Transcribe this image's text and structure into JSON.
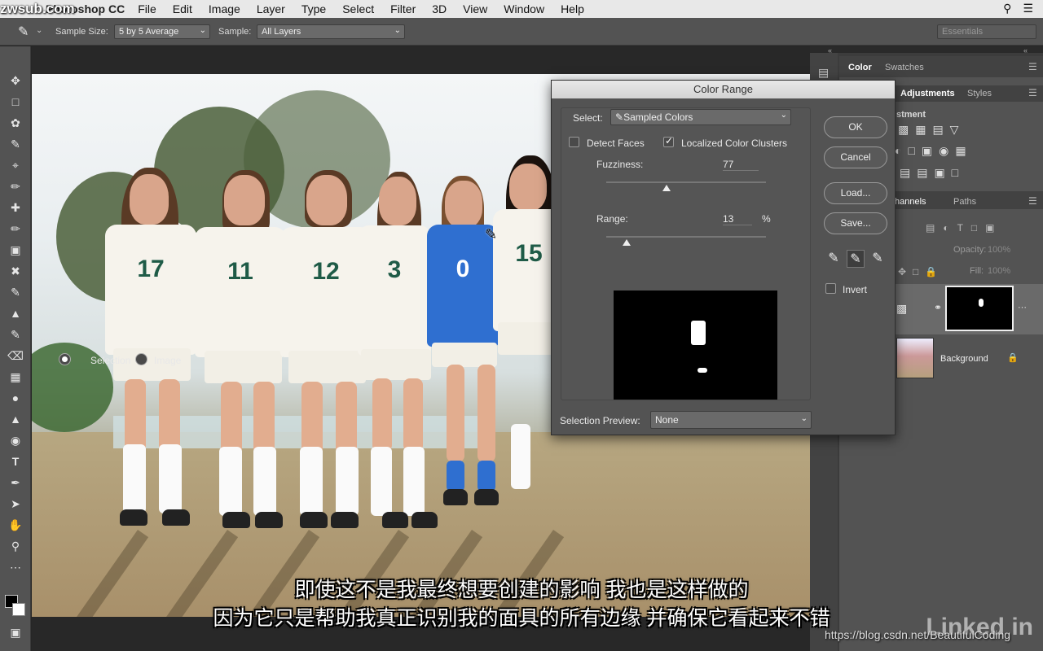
{
  "app": {
    "watermark": "zwsub.com",
    "title": "Photoshop CC"
  },
  "menu": {
    "items": [
      "File",
      "Edit",
      "Image",
      "Layer",
      "Type",
      "Select",
      "Filter",
      "3D",
      "View",
      "Window",
      "Help"
    ]
  },
  "options": {
    "sample_size_label": "Sample Size:",
    "sample_size_value": "5 by 5 Average",
    "sample_label": "Sample:",
    "sample_value": "All Layers",
    "workspace": "Essentials"
  },
  "panels": {
    "tab_color": "Color",
    "tab_swatches": "Swatches",
    "tab_adjustments": "Adjustments",
    "tab_styles": "Styles",
    "adjust_caption": "stment",
    "tab_channels": "hannels",
    "tab_paths": "Paths",
    "opacity_label": "Opacity:",
    "opacity_value": "100%",
    "fill_label": "Fill:",
    "fill_value": "100%",
    "layer_background": "Background"
  },
  "dialog": {
    "title": "Color Range",
    "select_label": "Select:",
    "select_value": "Sampled Colors",
    "detect_faces": "Detect Faces",
    "localized": "Localized Color Clusters",
    "fuzziness_label": "Fuzziness:",
    "fuzziness_value": "77",
    "fuzziness_fraction": 0.38,
    "range_label": "Range:",
    "range_value": "13",
    "range_unit": "%",
    "range_fraction": 0.13,
    "ok": "OK",
    "cancel": "Cancel",
    "load": "Load...",
    "save": "Save...",
    "invert": "Invert",
    "radio_selection": "Selection",
    "radio_image": "Image",
    "preview_label": "Selection Preview:",
    "preview_value": "None"
  },
  "photo": {
    "jerseys": [
      "17",
      "11",
      "12",
      "3",
      "0",
      "15"
    ]
  },
  "subtitles": {
    "line1": "即使这不是我最终想要创建的影响  我也是这样做的",
    "line2": "因为它只是帮助我真正识别我的面具的所有边缘  并确保它看起来不错"
  },
  "overlay": {
    "csdn": "https://blog.csdn.net/BeautifulCoding",
    "linkedin": "Linked in"
  },
  "colors": {
    "jersey_green": "#1f5b47",
    "keeper_blue": "#2f6fd0",
    "ui_panel": "#535353"
  }
}
